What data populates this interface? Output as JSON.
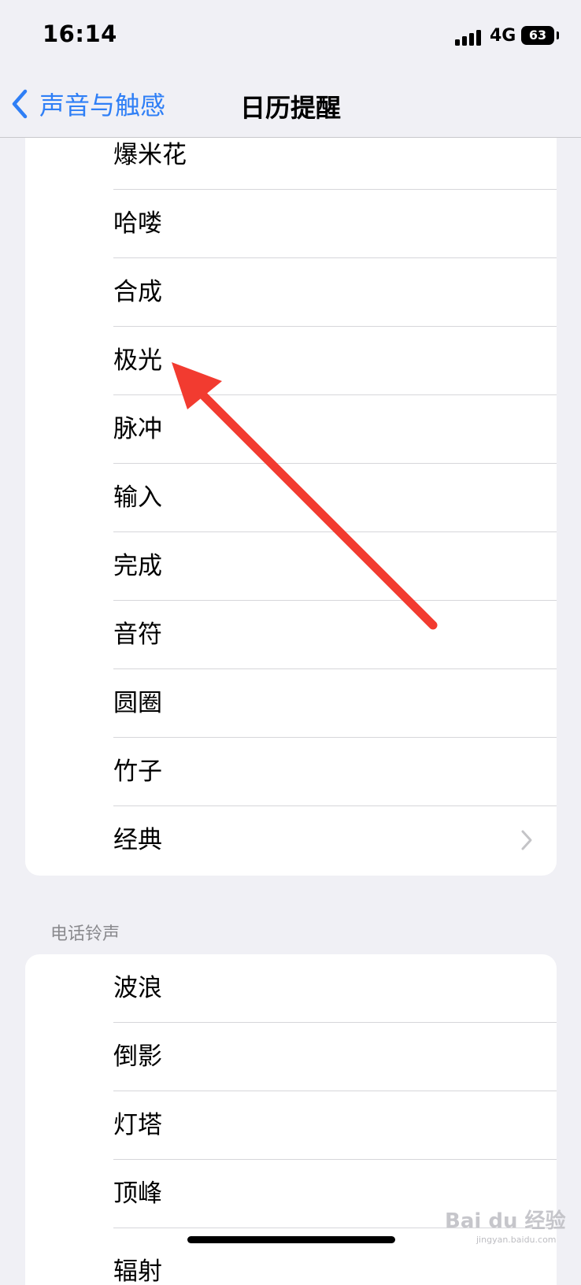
{
  "status_bar": {
    "time": "16:14",
    "network": "4G",
    "battery": "63"
  },
  "nav": {
    "back_label": "声音与触感",
    "title": "日历提醒"
  },
  "alert_tones": [
    "爆米花",
    "哈喽",
    "合成",
    "极光",
    "脉冲",
    "输入",
    "完成",
    "音符",
    "圆圈",
    "竹子",
    "经典"
  ],
  "ringtone_section": {
    "header": "电话铃声",
    "items": [
      "波浪",
      "倒影",
      "灯塔",
      "顶峰",
      "辐射"
    ]
  },
  "watermark": {
    "brand": "Bai du 经验",
    "url": "jingyan.baidu.com"
  },
  "colors": {
    "accent": "#2f7ff6",
    "annotation_arrow": "#f23b30"
  },
  "icons": {
    "back": "chevron-left-icon",
    "disclosure": "chevron-right-icon",
    "signal": "cellular-signal-icon",
    "battery": "battery-icon"
  }
}
